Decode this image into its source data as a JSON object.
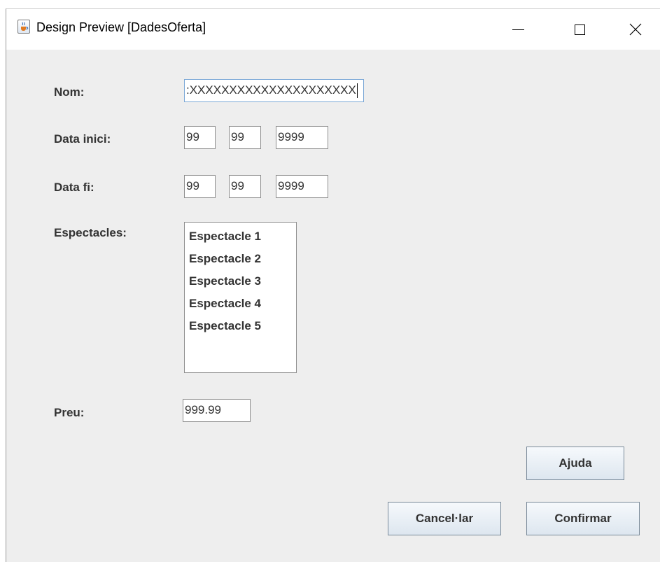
{
  "window": {
    "title": "Design Preview [DadesOferta]",
    "icons": {
      "app": "java-cup-icon",
      "minimize": "minimize-icon",
      "maximize": "maximize-icon",
      "close": "close-icon"
    }
  },
  "form": {
    "nom": {
      "label": "Nom:",
      "value": ":XXXXXXXXXXXXXXXXXXXXX"
    },
    "data_inici": {
      "label": "Data inici:",
      "day": "99",
      "month": "99",
      "year": "9999"
    },
    "data_fi": {
      "label": "Data fi:",
      "day": "99",
      "month": "99",
      "year": "9999"
    },
    "espectacles": {
      "label": "Espectacles:",
      "items": [
        "Espectacle 1",
        "Espectacle 2",
        "Espectacle 3",
        "Espectacle 4",
        "Espectacle 5"
      ]
    },
    "preu": {
      "label": "Preu:",
      "value": "999.99"
    }
  },
  "buttons": {
    "ajuda": "Ajuda",
    "cancelar": "Cancel·lar",
    "confirmar": "Confirmar"
  }
}
